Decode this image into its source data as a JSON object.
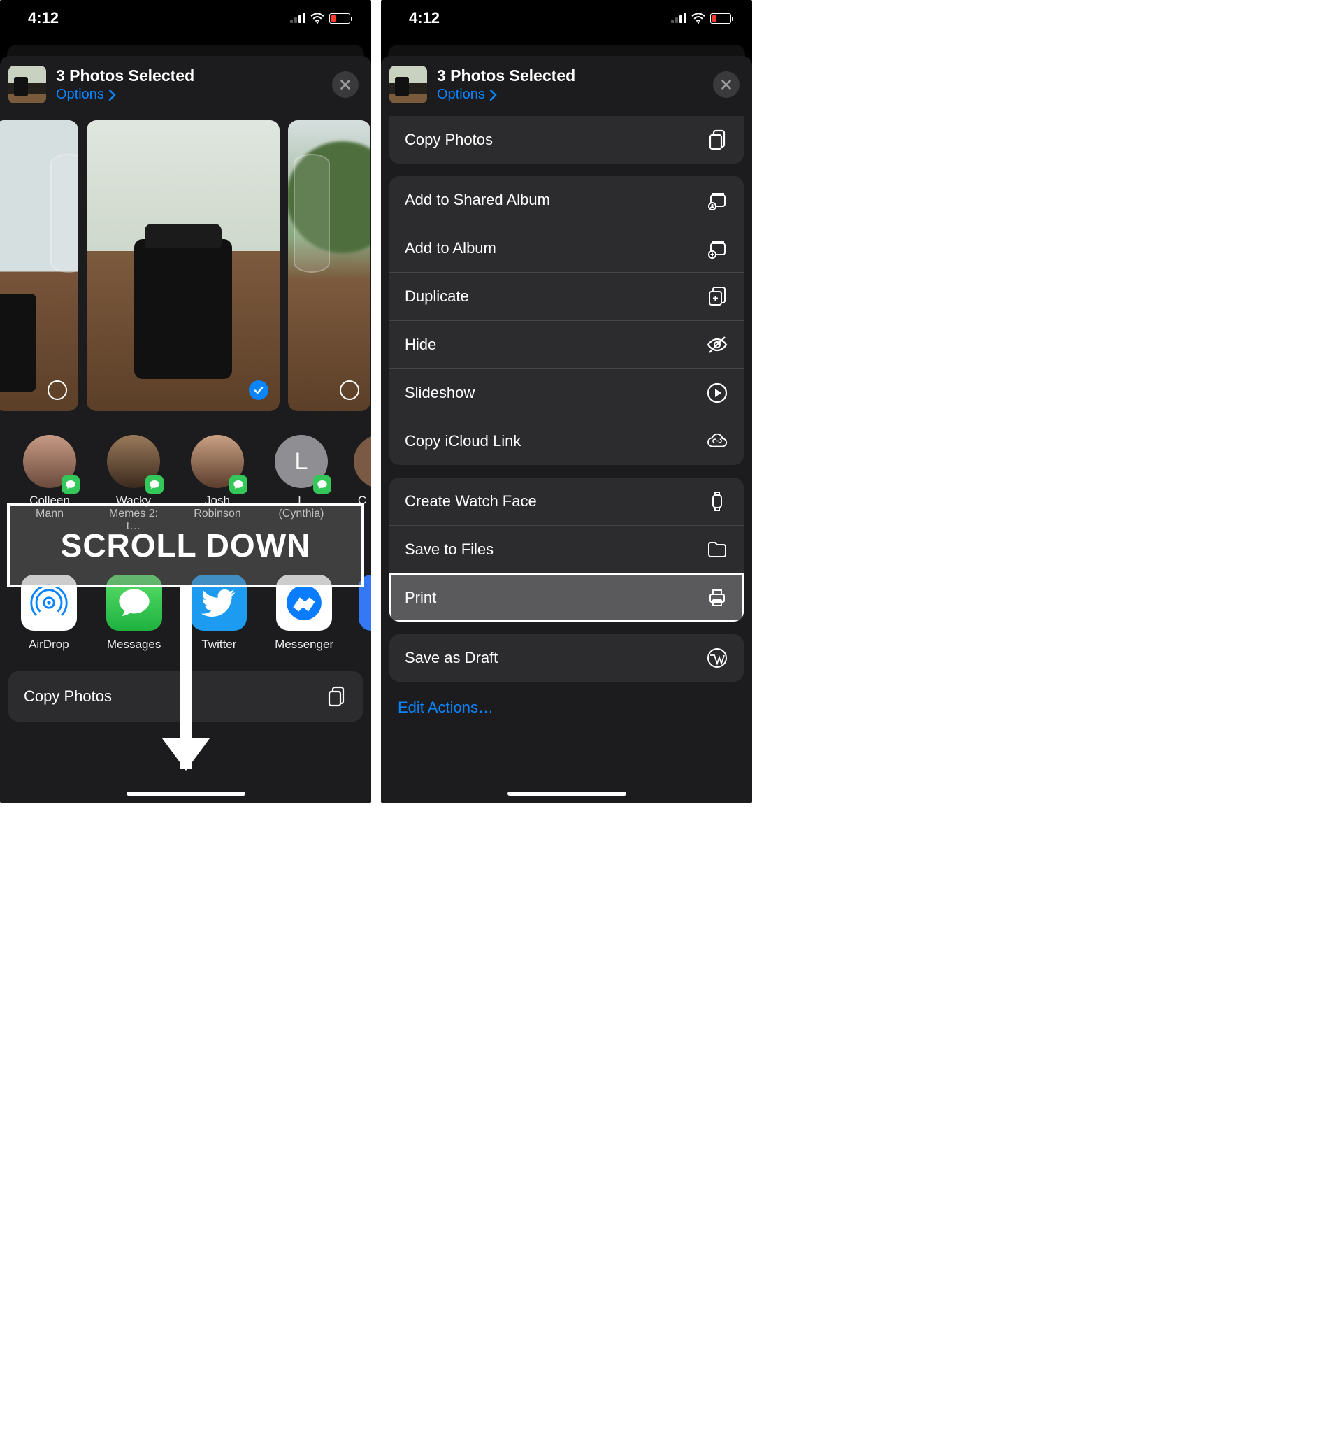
{
  "status": {
    "time": "4:12"
  },
  "header": {
    "title": "3 Photos Selected",
    "options": "Options"
  },
  "annotation": {
    "scroll": "SCROLL DOWN"
  },
  "contacts": [
    {
      "name": "Colleen",
      "sub": "Mann"
    },
    {
      "name": "Wacky",
      "sub": "Memes 2: t…"
    },
    {
      "name": "Josh",
      "sub": "Robinson"
    },
    {
      "name": "L",
      "sub": "(Cynthia)",
      "initial": "L"
    },
    {
      "name": "C",
      "sub": ""
    }
  ],
  "apps": [
    {
      "name": "AirDrop"
    },
    {
      "name": "Messages"
    },
    {
      "name": "Twitter"
    },
    {
      "name": "Messenger"
    }
  ],
  "actions": {
    "copy_photos": "Copy Photos",
    "add_shared": "Add to Shared Album",
    "add_album": "Add to Album",
    "duplicate": "Duplicate",
    "hide": "Hide",
    "slideshow": "Slideshow",
    "copy_icloud": "Copy iCloud Link",
    "watch_face": "Create Watch Face",
    "save_files": "Save to Files",
    "print": "Print",
    "save_draft": "Save as Draft",
    "edit": "Edit Actions…"
  }
}
